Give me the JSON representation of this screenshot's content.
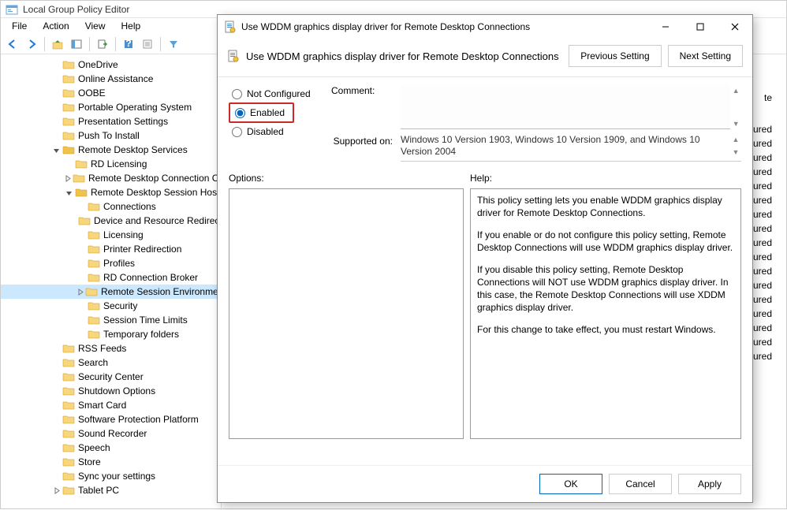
{
  "window": {
    "title": "Local Group Policy Editor"
  },
  "menu": {
    "file": "File",
    "action": "Action",
    "view": "View",
    "help": "Help"
  },
  "tree": {
    "items": [
      {
        "label": "OneDrive",
        "indent": 4,
        "exp": ""
      },
      {
        "label": "Online Assistance",
        "indent": 4,
        "exp": ""
      },
      {
        "label": "OOBE",
        "indent": 4,
        "exp": ""
      },
      {
        "label": "Portable Operating System",
        "indent": 4,
        "exp": ""
      },
      {
        "label": "Presentation Settings",
        "indent": 4,
        "exp": ""
      },
      {
        "label": "Push To Install",
        "indent": 4,
        "exp": ""
      },
      {
        "label": "Remote Desktop Services",
        "indent": 4,
        "exp": "v",
        "open": true
      },
      {
        "label": "RD Licensing",
        "indent": 5,
        "exp": ""
      },
      {
        "label": "Remote Desktop Connection Client",
        "indent": 5,
        "exp": ">"
      },
      {
        "label": "Remote Desktop Session Host",
        "indent": 5,
        "exp": "v",
        "open": true
      },
      {
        "label": "Connections",
        "indent": 6,
        "exp": ""
      },
      {
        "label": "Device and Resource Redirection",
        "indent": 6,
        "exp": ""
      },
      {
        "label": "Licensing",
        "indent": 6,
        "exp": ""
      },
      {
        "label": "Printer Redirection",
        "indent": 6,
        "exp": ""
      },
      {
        "label": "Profiles",
        "indent": 6,
        "exp": ""
      },
      {
        "label": "RD Connection Broker",
        "indent": 6,
        "exp": ""
      },
      {
        "label": "Remote Session Environment",
        "indent": 6,
        "exp": ">",
        "selected": true
      },
      {
        "label": "Security",
        "indent": 6,
        "exp": ""
      },
      {
        "label": "Session Time Limits",
        "indent": 6,
        "exp": ""
      },
      {
        "label": "Temporary folders",
        "indent": 6,
        "exp": ""
      },
      {
        "label": "RSS Feeds",
        "indent": 4,
        "exp": ""
      },
      {
        "label": "Search",
        "indent": 4,
        "exp": ""
      },
      {
        "label": "Security Center",
        "indent": 4,
        "exp": ""
      },
      {
        "label": "Shutdown Options",
        "indent": 4,
        "exp": ""
      },
      {
        "label": "Smart Card",
        "indent": 4,
        "exp": ""
      },
      {
        "label": "Software Protection Platform",
        "indent": 4,
        "exp": ""
      },
      {
        "label": "Sound Recorder",
        "indent": 4,
        "exp": ""
      },
      {
        "label": "Speech",
        "indent": 4,
        "exp": ""
      },
      {
        "label": "Store",
        "indent": 4,
        "exp": ""
      },
      {
        "label": "Sync your settings",
        "indent": 4,
        "exp": ""
      },
      {
        "label": "Tablet PC",
        "indent": 4,
        "exp": ">"
      }
    ]
  },
  "right_pane": {
    "frag1": "te",
    "states": [
      "figured",
      "figured",
      "figured",
      "figured",
      "figured",
      "figured",
      "figured",
      "figured",
      "figured",
      "figured",
      "figured",
      "figured",
      "figured",
      "figured",
      "figured",
      "figured",
      "figured"
    ]
  },
  "dialog": {
    "title": "Use WDDM graphics display driver for Remote Desktop Connections",
    "header_title": "Use WDDM graphics display driver for Remote Desktop Connections",
    "prev_btn": "Previous Setting",
    "next_btn": "Next Setting",
    "radio": {
      "not_configured": "Not Configured",
      "enabled": "Enabled",
      "disabled": "Disabled",
      "selected": "enabled"
    },
    "comment_label": "Comment:",
    "comment_value": "",
    "supported_label": "Supported on:",
    "supported_value": "Windows 10 Version 1903, Windows 10 Version 1909, and Windows 10 Version 2004",
    "options_label": "Options:",
    "help_label": "Help:",
    "help_p1": "This policy setting lets you enable WDDM graphics display driver for Remote Desktop Connections.",
    "help_p2": "If you enable or do not configure this policy setting, Remote Desktop Connections will use WDDM graphics display driver.",
    "help_p3": "If you disable this policy setting, Remote Desktop Connections will NOT use WDDM graphics display driver. In this case, the Remote Desktop Connections will use XDDM graphics display driver.",
    "help_p4": "For this change to take effect, you must restart Windows.",
    "ok": "OK",
    "cancel": "Cancel",
    "apply": "Apply"
  }
}
